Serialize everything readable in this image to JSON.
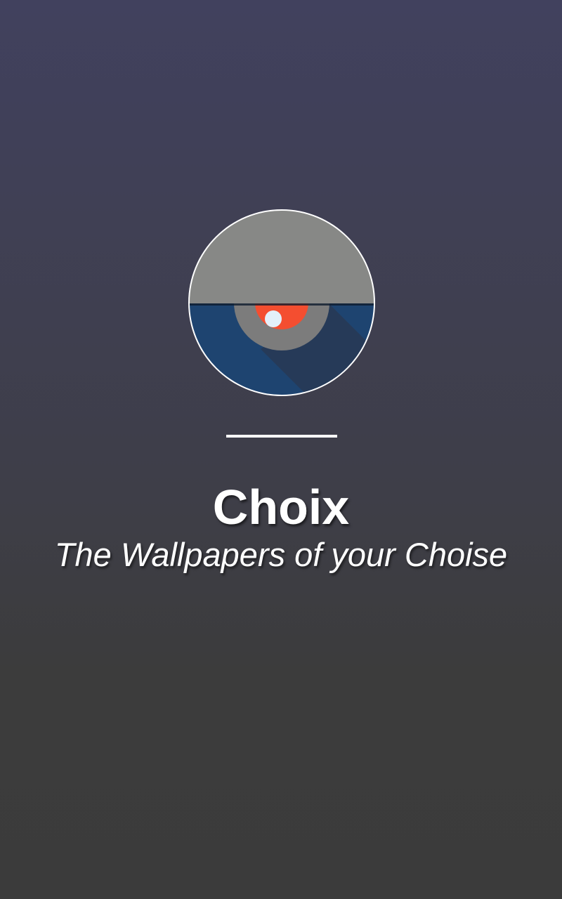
{
  "splash": {
    "app_name": "Choix",
    "tagline": "The Wallpapers of your Choise"
  },
  "logo": {
    "icon": "wallpaper-eye-logo-icon"
  },
  "colors": {
    "background_top": "#41415e",
    "background_bottom": "#3b3b3b",
    "logo_gray": "#878886",
    "logo_blue": "#1e4470",
    "logo_red": "#f44e30",
    "logo_dot": "#e3f0fa",
    "text": "#ffffff"
  }
}
